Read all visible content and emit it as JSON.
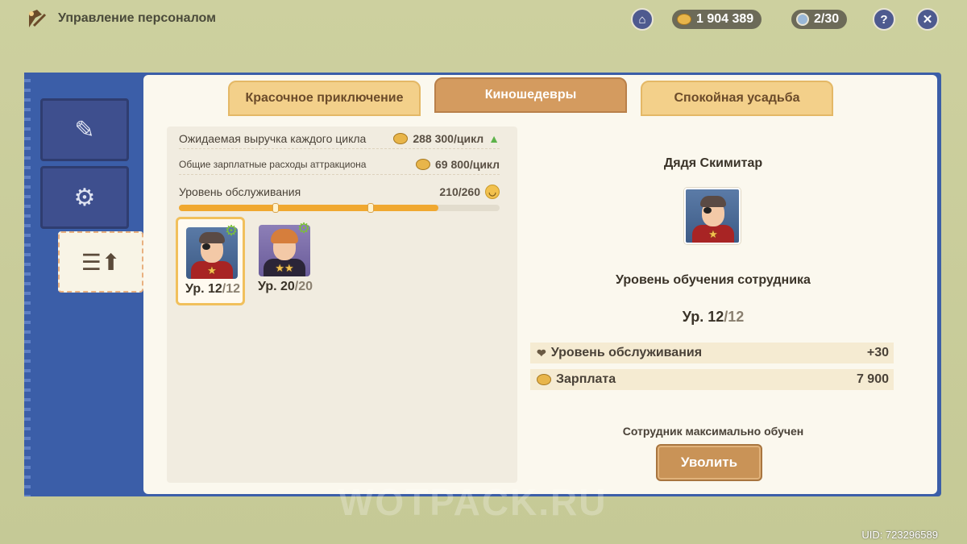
{
  "header": {
    "title": "Управление персоналом",
    "currency": "1 904 389",
    "staff_count": "2/30",
    "help_label": "?",
    "close_label": "✕"
  },
  "tabs": [
    {
      "label": "Красочное приключение",
      "active": false
    },
    {
      "label": "Киношедевры",
      "active": true
    },
    {
      "label": "Спокойная усадьба",
      "active": false
    }
  ],
  "stats": {
    "revenue_label": "Ожидаемая выручка каждого цикла",
    "revenue_value": "288 300/цикл",
    "salary_label": "Общие зарплатные расходы аттракциона",
    "salary_value": "69 800/цикл",
    "service_label": "Уровень обслуживания",
    "service_value": "210/260",
    "service_fraction": 0.808
  },
  "staff": [
    {
      "level": "Ур. 12",
      "max": "/12",
      "stars": "★",
      "selected": true
    },
    {
      "level": "Ур. 20",
      "max": "/20",
      "stars": "★★",
      "selected": false
    }
  ],
  "detail": {
    "name": "Дядя Скимитар",
    "stars": "★",
    "title": "Уровень обучения сотрудника",
    "level": "Ур. 12",
    "level_max": "/12",
    "service_label": "Уровень обслуживания",
    "service_value": "+30",
    "salary_label": "Зарплата",
    "salary_value": "7 900",
    "note": "Сотрудник максимально обучен",
    "fire_button": "Уволить"
  },
  "watermark": "WOTPACK.RU",
  "uid": "UID: 723296589"
}
